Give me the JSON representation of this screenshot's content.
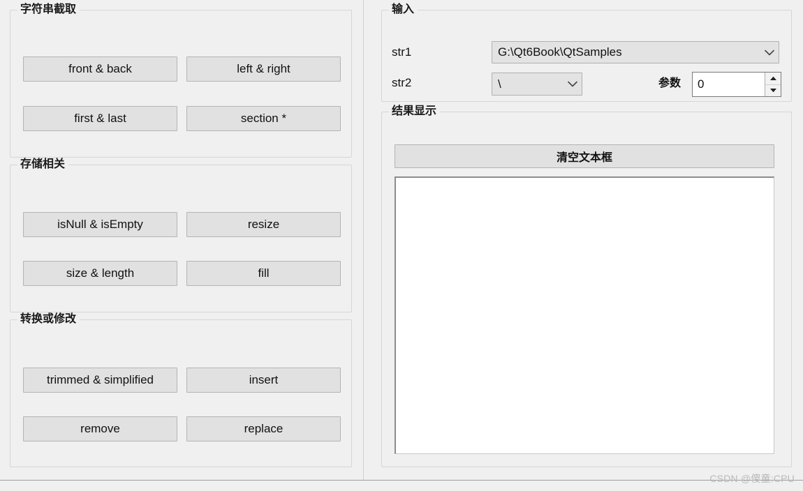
{
  "window": {
    "background_color": "#f0f0f0",
    "watermark": "CSDN @傻童:CPU"
  },
  "left_panel": {
    "groups": [
      {
        "name": "substring-group",
        "title": "字符串截取",
        "buttons": [
          {
            "name": "front-and-back-button",
            "label": "front & back"
          },
          {
            "name": "left-and-right-button",
            "label": "left & right"
          },
          {
            "name": "first-and-last-button",
            "label": "first & last"
          },
          {
            "name": "section-button",
            "label": "section *"
          }
        ]
      },
      {
        "name": "storage-group",
        "title": "存储相关",
        "buttons": [
          {
            "name": "isnull-and-isempty-button",
            "label": "isNull & isEmpty"
          },
          {
            "name": "resize-button",
            "label": "resize"
          },
          {
            "name": "size-and-length-button",
            "label": "size & length"
          },
          {
            "name": "fill-button",
            "label": "fill"
          }
        ]
      },
      {
        "name": "convert-group",
        "title": "转换或修改",
        "buttons": [
          {
            "name": "trimmed-and-simplified-button",
            "label": "trimmed & simplified"
          },
          {
            "name": "insert-button",
            "label": "insert"
          },
          {
            "name": "remove-button",
            "label": "remove"
          },
          {
            "name": "replace-button",
            "label": "replace"
          }
        ]
      }
    ]
  },
  "right_panel": {
    "input_group": {
      "title": "输入",
      "str1": {
        "label": "str1",
        "value": "G:\\Qt6Book\\QtSamples",
        "placeholder": "",
        "arrow_icon": "chevron-down-icon"
      },
      "str2": {
        "label": "str2",
        "value": "\\",
        "placeholder": "",
        "arrow_icon": "chevron-down-icon"
      },
      "param": {
        "label": "参数",
        "value": "0",
        "up_icon": "triangle-up-icon",
        "down_icon": "triangle-down-icon"
      }
    },
    "result_group": {
      "title": "结果显示",
      "clear_button": "清空文本框",
      "output_text": ""
    }
  }
}
